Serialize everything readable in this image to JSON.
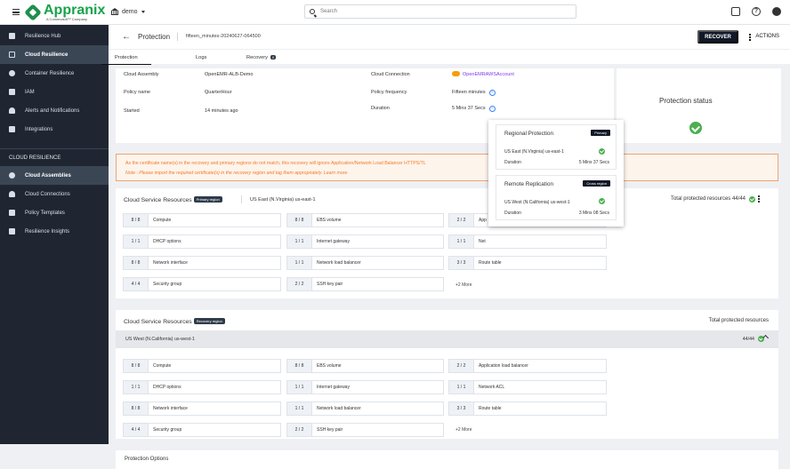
{
  "header": {
    "logo": "Appranix",
    "logo_sub": "A Commvault™ Company",
    "tenant": "demo",
    "search_placeholder": "Search"
  },
  "sidebar": {
    "items": [
      {
        "label": "Resilience Hub",
        "icon": "home-icon"
      },
      {
        "label": "Cloud Resilience",
        "icon": "resilience-icon",
        "active": true
      },
      {
        "label": "Container Resilience",
        "icon": "container-icon"
      },
      {
        "label": "IAM",
        "icon": "iam-icon"
      },
      {
        "label": "Alerts and Notifications",
        "icon": "bell-icon"
      },
      {
        "label": "Integrations",
        "icon": "integration-icon"
      }
    ],
    "section_title": "CLOUD RESILIENCE",
    "section_items": [
      {
        "label": "Cloud Assemblies",
        "icon": "gear-icon",
        "active": true
      },
      {
        "label": "Cloud Connections",
        "icon": "cloud-icon"
      },
      {
        "label": "Policy Templates",
        "icon": "template-icon"
      },
      {
        "label": "Resilience Insights",
        "icon": "insight-icon"
      }
    ]
  },
  "page": {
    "back_icon": "arrow-left-icon",
    "title": "Protection",
    "subtitle": "fifteen_minutes-20240627-064500",
    "recover": "RECOVER",
    "actions": "ACTIONS",
    "tabs": [
      "Protection",
      "Logs",
      "Recovery"
    ],
    "recovery_badge": "0"
  },
  "summary": {
    "cloud_assembly_label": "Cloud Assembly",
    "cloud_assembly": "OpenEMR-ALB-Demo",
    "policy_label": "Policy name",
    "policy": "QuarterHour",
    "started_label": "Started",
    "started": "14 minutes ago",
    "connection_label": "Cloud Connection",
    "connection": "OpenEMRAWSAccount",
    "frequency_label": "Policy frequency",
    "frequency": "Fifteen minutes",
    "duration_label": "Duration",
    "duration": "5 Mins 37 Secs",
    "status_title": "Protection status"
  },
  "warning": {
    "message": "As the certificate name(s) in the recovery and primary regions do not match, this recovery will ignore Application/Network Load Balancer HTTPS/TL",
    "note_prefix": "Note : Please import the required certificate(s) in the recovery region and tag them appropriately.",
    "learn_more": "Learn more"
  },
  "primary_resources": {
    "title": "Cloud Service Resources",
    "badge": "Primary region",
    "region": "US East (N.Virginia) us-east-1",
    "total": "Total protected resources 44/44",
    "items": [
      [
        "8 / 8",
        "Compute"
      ],
      [
        "8 / 8",
        "EBS volume"
      ],
      [
        "2 / 2",
        "App"
      ],
      [
        "1 / 1",
        "DHCP options"
      ],
      [
        "1 / 1",
        "Internet gateway"
      ],
      [
        "1 / 1",
        "Net"
      ],
      [
        "8 / 8",
        "Network interface"
      ],
      [
        "1 / 1",
        "Network load balancer"
      ],
      [
        "3 / 3",
        "Route table"
      ],
      [
        "4 / 4",
        "Security group"
      ],
      [
        "2 / 2",
        "SSH key pair"
      ]
    ],
    "more": "+2 More"
  },
  "recovery_resources": {
    "title": "Cloud Service Resources",
    "badge": "Recovery region",
    "total": "Total protected resources",
    "region": "US West (N.California) us-west-1",
    "count": "44/44",
    "items": [
      [
        "8 / 8",
        "Compute"
      ],
      [
        "8 / 8",
        "EBS volume"
      ],
      [
        "2 / 2",
        "Application load balancer"
      ],
      [
        "1 / 1",
        "DHCP options"
      ],
      [
        "1 / 1",
        "Internet gateway"
      ],
      [
        "1 / 1",
        "Network ACL"
      ],
      [
        "8 / 8",
        "Network interface"
      ],
      [
        "1 / 1",
        "Network load balancer"
      ],
      [
        "3 / 3",
        "Route table"
      ],
      [
        "4 / 4",
        "Security group"
      ],
      [
        "2 / 2",
        "SSH key pair"
      ]
    ],
    "more": "+2 More"
  },
  "popover": {
    "regional_title": "Regional Protection",
    "regional_badge": "Primary",
    "regional_region": "US East (N.Virginia) us-east-1",
    "regional_duration_label": "Duration",
    "regional_duration": "5 Mins 37 Secs",
    "remote_title": "Remote Replication",
    "remote_badge": "Cross region",
    "remote_region": "US West (N.California) us-west-1",
    "remote_duration_label": "Duration",
    "remote_duration": "3 Mins 08 Secs"
  },
  "options": {
    "title": "Protection Options"
  }
}
